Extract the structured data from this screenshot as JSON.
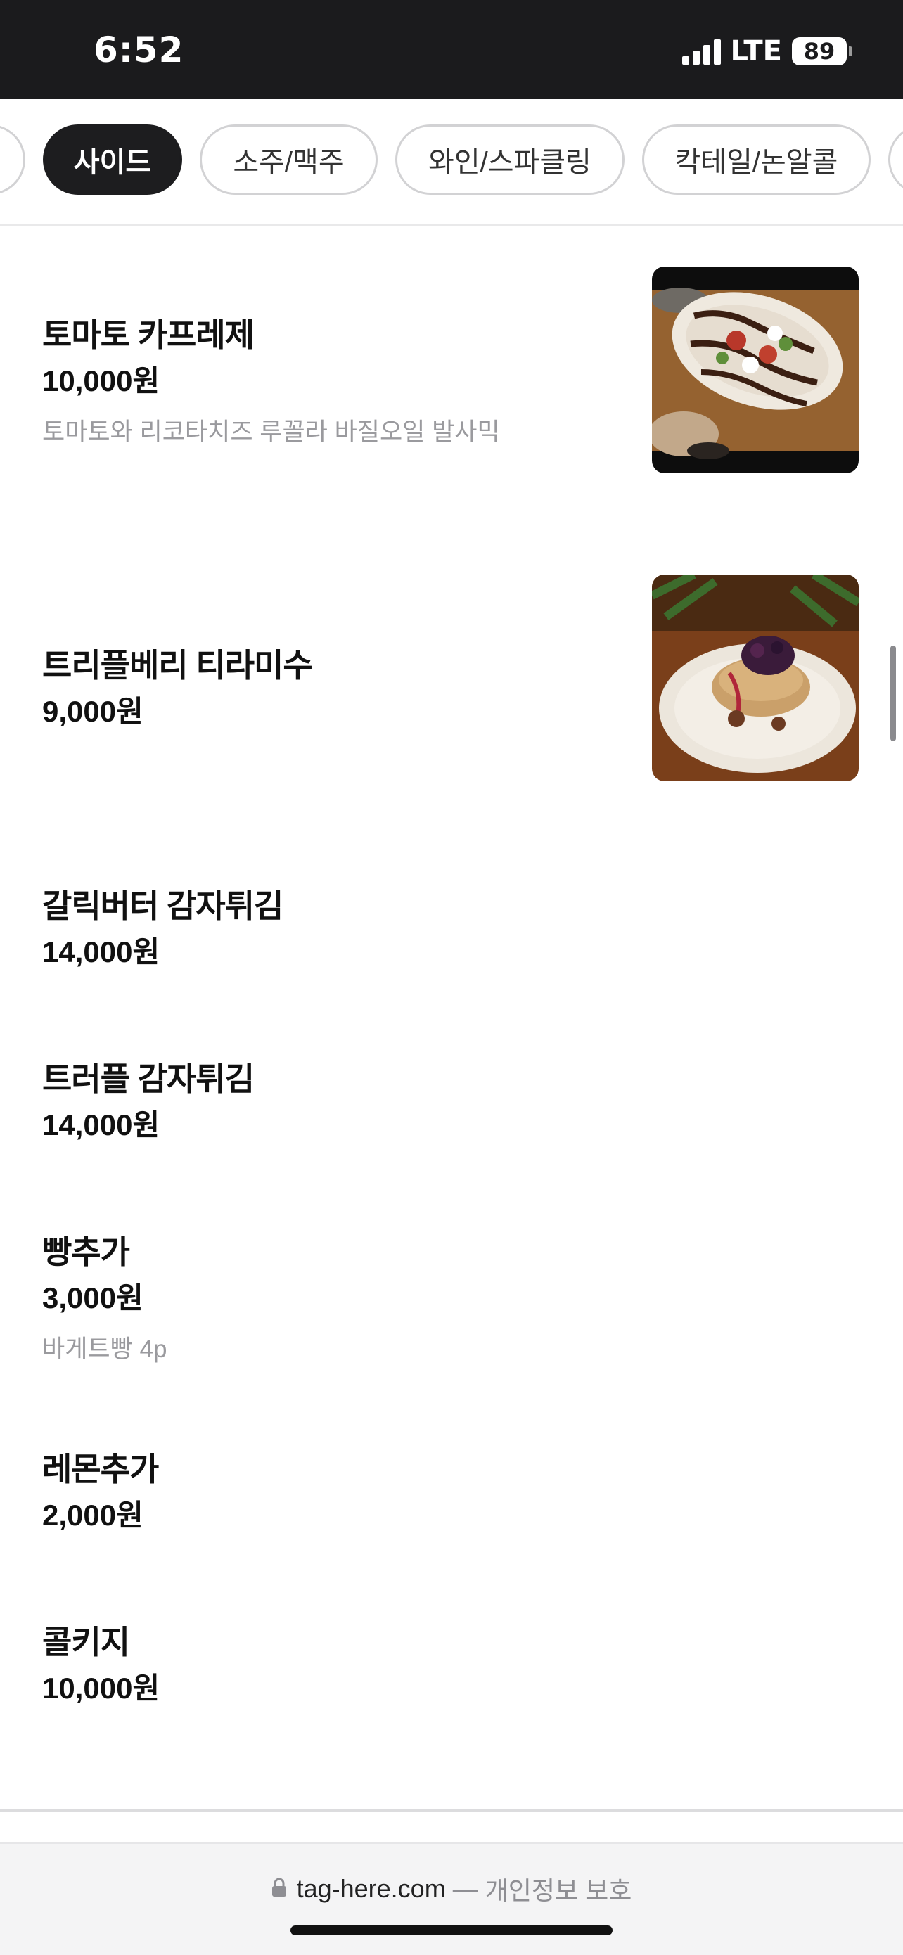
{
  "status_bar": {
    "time": "6:52",
    "network": "LTE",
    "battery": "89"
  },
  "tabs": [
    {
      "label": "",
      "active": false
    },
    {
      "label": "사이드",
      "active": true
    },
    {
      "label": "소주/맥주",
      "active": false
    },
    {
      "label": "와인/스파클링",
      "active": false
    },
    {
      "label": "칵테일/논알콜",
      "active": false
    },
    {
      "label": "",
      "active": false
    }
  ],
  "menu": {
    "items": [
      {
        "name": "토마토 카프레제",
        "price": "10,000원",
        "desc": "토마토와 리코타치즈 루꼴라 바질오일 발사믹",
        "photo": "caprese-photo"
      },
      {
        "name": "트리플베리 티라미수",
        "price": "9,000원",
        "photo": "tiramisu-photo"
      },
      {
        "name": "갈릭버터 감자튀김",
        "price": "14,000원"
      },
      {
        "name": "트러플 감자튀김",
        "price": "14,000원"
      },
      {
        "name": "빵추가",
        "price": "3,000원",
        "desc": "바게트빵 4p"
      },
      {
        "name": "레몬추가",
        "price": "2,000원"
      },
      {
        "name": "콜키지",
        "price": "10,000원"
      }
    ]
  },
  "browser": {
    "url": "tag-here.com",
    "separator": "—",
    "privacy": "개인정보 보호"
  },
  "colors": {
    "accent": "#1d1d1f",
    "muted_text": "#9a9a9e",
    "status_bar_bg": "#1b1b1d"
  }
}
